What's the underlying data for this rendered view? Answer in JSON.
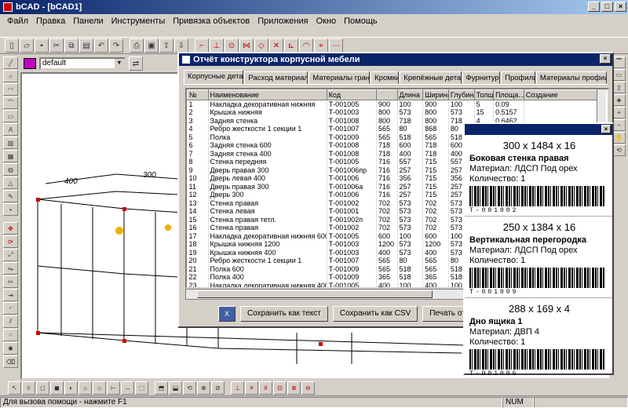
{
  "window": {
    "title": "bCAD - [bCAD1]"
  },
  "menu": [
    "Файл",
    "Правка",
    "Панели",
    "Инструменты",
    "Привязка объектов",
    "Приложения",
    "Окно",
    "Помощь"
  ],
  "layer": {
    "name": "default"
  },
  "status": {
    "hint": "Для вызова помощи - нажмите F1",
    "num": "NUM"
  },
  "dialog": {
    "title": "Отчёт конструктора корпусной мебели",
    "tabs": [
      "Корпусные детали",
      "Расход материалов",
      "Материалы граней",
      "Кромки",
      "Крепёжные детали",
      "Фурнитура",
      "Профили",
      "Материалы профилей"
    ],
    "columns": [
      "№",
      "Наименование",
      "Код",
      "",
      "Длина",
      "Ширина",
      "Глубина",
      "Толщина",
      "Площа...",
      "Создание"
    ],
    "rows": [
      [
        "1",
        "Накладка декоративная нижняя",
        "Т-001005",
        "900",
        "100",
        "900",
        "100",
        "5",
        "0.09",
        ""
      ],
      [
        "2",
        "Крышка нижняя",
        "Т-001003",
        "800",
        "573",
        "800",
        "573",
        "15",
        "0.5157",
        ""
      ],
      [
        "3",
        "Задняя стенка",
        "Т-001008",
        "800",
        "718",
        "800",
        "718",
        "4",
        "0.6462",
        ""
      ],
      [
        "4",
        "Ребро жесткости 1 секции 1",
        "Т-001007",
        "565",
        "80",
        "868",
        "80",
        "",
        "",
        ""
      ],
      [
        "5",
        "Полка",
        "Т-001009",
        "565",
        "518",
        "565",
        "518",
        "",
        "",
        ""
      ],
      [
        "6",
        "Задняя стенка 600",
        "Т-001008",
        "718",
        "600",
        "718",
        "600",
        "",
        "",
        ""
      ],
      [
        "7",
        "Задняя стенка 400",
        "Т-001008",
        "718",
        "400",
        "718",
        "400",
        "",
        "",
        ""
      ],
      [
        "8",
        "Стенка передняя",
        "Т-001005",
        "716",
        "557",
        "715",
        "557",
        "",
        "",
        ""
      ],
      [
        "9",
        "Дверь правая 300",
        "Т-001006пр",
        "716",
        "257",
        "715",
        "257",
        "",
        "",
        ""
      ],
      [
        "10",
        "Дверь левая 400",
        "Т-001006",
        "716",
        "356",
        "715",
        "356",
        "",
        "",
        ""
      ],
      [
        "11",
        "Дверь правая 300",
        "Т-001006а",
        "716",
        "257",
        "715",
        "257",
        "",
        "",
        ""
      ],
      [
        "12",
        "Дверь 300",
        "Т-001006",
        "716",
        "257",
        "715",
        "257",
        "",
        "",
        ""
      ],
      [
        "13",
        "Стенка правая",
        "Т-001002",
        "702",
        "573",
        "702",
        "573",
        "",
        "",
        ""
      ],
      [
        "14",
        "Стенка левая",
        "Т-001001",
        "702",
        "573",
        "702",
        "573",
        "",
        "",
        ""
      ],
      [
        "15",
        "Стенка правая тетл.",
        "Т-001002п",
        "702",
        "573",
        "702",
        "573",
        "",
        "",
        ""
      ],
      [
        "16",
        "Стенка правая",
        "Т-001002",
        "702",
        "573",
        "702",
        "573",
        "",
        "",
        ""
      ],
      [
        "17",
        "Накладка декоративная нижняя 600",
        "Т-001005",
        "600",
        "100",
        "600",
        "100",
        "",
        "",
        ""
      ],
      [
        "18",
        "Крышка нижняя 1200",
        "Т-001003",
        "1200",
        "573",
        "1200",
        "573",
        "",
        "",
        ""
      ],
      [
        "19",
        "Крышка нижняя 400",
        "Т-001003",
        "400",
        "573",
        "400",
        "573",
        "",
        "",
        ""
      ],
      [
        "20",
        "Ребро жесткости 1 секции 1",
        "Т-001007",
        "565",
        "80",
        "565",
        "80",
        "",
        "",
        ""
      ],
      [
        "21",
        "Полка 600",
        "Т-001009",
        "565",
        "518",
        "565",
        "518",
        "",
        "",
        ""
      ],
      [
        "22",
        "Полка 400",
        "Т-001009",
        "365",
        "518",
        "365",
        "518",
        "",
        "",
        ""
      ],
      [
        "23",
        "Накладка декоративная нижняя 400",
        "Т-001005",
        "400",
        "100",
        "400",
        "100",
        "",
        "",
        ""
      ]
    ],
    "buttons": {
      "save_text": "Сохранить как текст",
      "save_csv": "Сохранить как CSV",
      "print": "Печать отчёта"
    }
  },
  "labels": [
    {
      "size": "300 x 1484 x 16",
      "name": "Боковая стенка правая",
      "material": "Материал: ЛДСП Под орех",
      "qty": "Количество: 1",
      "code": "Т-001002"
    },
    {
      "size": "250 x 1384 x 16",
      "name": "Вертикальная перегородка",
      "material": "Материал: ЛДСП Под орех",
      "qty": "Количество: 1",
      "code": "Т-001009"
    },
    {
      "size": "288 x 169 x 4",
      "name": "Дно ящика 1",
      "material": "Материал: ДВП 4",
      "qty": "Количество: 1",
      "code": "Т-001006"
    }
  ],
  "drawing": {
    "dim1": "400",
    "dim2": "300"
  }
}
